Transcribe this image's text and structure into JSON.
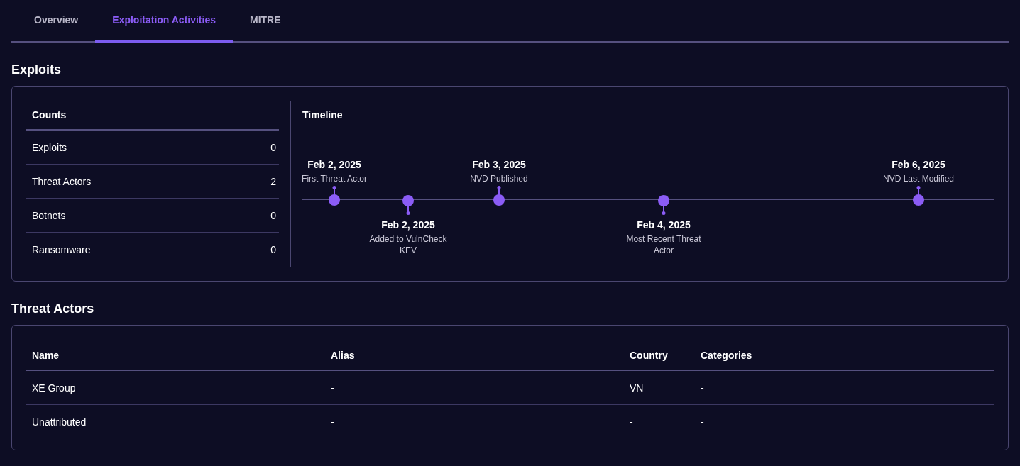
{
  "tabs": [
    {
      "label": "Overview",
      "selected": false
    },
    {
      "label": "Exploitation Activities",
      "selected": true
    },
    {
      "label": "MITRE",
      "selected": false
    }
  ],
  "exploits": {
    "title": "Exploits",
    "counts": {
      "title": "Counts",
      "rows": [
        {
          "label": "Exploits",
          "value": "0"
        },
        {
          "label": "Threat Actors",
          "value": "2"
        },
        {
          "label": "Botnets",
          "value": "0"
        },
        {
          "label": "Ransomware",
          "value": "0"
        }
      ]
    },
    "timeline": {
      "title": "Timeline",
      "events": [
        {
          "date": "Feb 2, 2025",
          "label": "First Threat Actor",
          "kind": "above"
        },
        {
          "date": "Feb 2, 2025",
          "label": "Added to VulnCheck KEV",
          "kind": "below"
        },
        {
          "date": "Feb 3, 2025",
          "label": "NVD Published",
          "kind": "above"
        },
        {
          "date": "Feb 4, 2025",
          "label": "Most Recent Threat Actor",
          "kind": "below"
        },
        {
          "date": "Feb 6, 2025",
          "label": "NVD Last Modified",
          "kind": "above"
        }
      ]
    }
  },
  "threat_actors": {
    "title": "Threat Actors",
    "columns": [
      "Name",
      "Alias",
      "Country",
      "Categories"
    ],
    "rows": [
      [
        "XE Group",
        "-",
        "VN",
        "-"
      ],
      [
        "Unattributed",
        "-",
        "-",
        "-"
      ]
    ]
  }
}
